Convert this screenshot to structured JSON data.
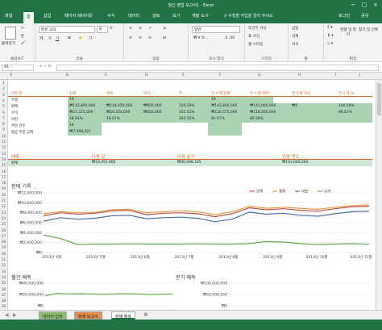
{
  "window": {
    "title": "월간 영업 보고서1 - Excel",
    "min": "−",
    "max": "□",
    "close": "×"
  },
  "ribbon_tabs": [
    "파일",
    "홈",
    "삽입",
    "페이지 레이아웃",
    "수식",
    "데이터",
    "검토",
    "보기",
    "개발 도구"
  ],
  "tell_me": "♀ 수행할 작업을 알려 주세요",
  "account": {
    "login": "로그인",
    "share": "공유"
  },
  "ribbon": {
    "paste": "붙여넣기",
    "clipboard": "클립보드",
    "font_name": "맑은 고딕",
    "font_size": "8",
    "font": "글꼴",
    "alignment": "맞춤",
    "number_format": "일반",
    "number": "표시 형식",
    "cond_format": "조건부 서식",
    "table_format": "표 서식",
    "cell_styles": "셀 스타일",
    "styles": "스타일",
    "insert": "삽입",
    "delete": "삭제",
    "format": "서식",
    "cells": "셀",
    "sort_filter": "정렬 및 필터",
    "find_select": "찾기 및 선택",
    "editing": "편집"
  },
  "name_box": "A1",
  "columns": [
    "A",
    "B",
    "C",
    "D",
    "E",
    "F",
    "G",
    "H",
    "I",
    "J"
  ],
  "rows": [
    "1",
    "2",
    "3",
    "4",
    "5",
    "6",
    "7",
    "8",
    "9",
    "10",
    "11",
    "12",
    "13",
    "14",
    "15",
    "16",
    "17",
    "18",
    "19",
    "20",
    "21",
    "22",
    "23",
    "24",
    "25",
    "26",
    "27",
    "28",
    "29",
    "30",
    "31",
    "32",
    "33",
    "34",
    "35",
    "36",
    "37",
    "38",
    "39"
  ],
  "table": {
    "headers": [
      "이번 달",
      "실제",
      "계획",
      "차이",
      "%",
      "연 누계 실제",
      "연 누계 계획",
      "연 누계 차이",
      "연 누계 %"
    ],
    "rows": [
      [
        "수량",
        "19",
        "",
        "",
        "",
        "19",
        "",
        "",
        ""
      ],
      [
        "판매",
        "₩143,800,000",
        "₩144,650,000",
        "₩850,000",
        "100.59%",
        "₩143,800,000",
        "₩143,000,000",
        "₩0",
        "100.59%"
      ],
      [
        "수익",
        "₩27,225,000",
        "₩26,550,000",
        "₩650,000",
        "102.52%",
        "₩116,575,000",
        "₩116,500,000",
        "",
        "99.41%"
      ],
      [
        "마진",
        "18.93%",
        "19.41%",
        "",
        "102.52%",
        "81.07%",
        "80.59%",
        "",
        ""
      ],
      [
        "주문 건수",
        "19",
        "",
        "",
        "",
        "-",
        "",
        "",
        ""
      ],
      [
        "평균 주문 금액",
        "₩7,568,421",
        "",
        "",
        "",
        "-",
        "",
        "",
        ""
      ]
    ]
  },
  "forecast": {
    "labels": [
      "예측",
      "다음 달",
      "다음 분기",
      "연중 연도"
    ],
    "row_label": "판매",
    "values": [
      "₩19,451,904",
      "₩46,098,185",
      "₩143,000,000"
    ]
  },
  "sales_history": {
    "title": "판매 기록"
  },
  "monthly_forecast": {
    "title": "월간 예측",
    "ticks": [
      "₩40,000,000",
      "₩20,000,000",
      "₩0"
    ]
  },
  "quarterly_forecast": {
    "title": "분기 예측",
    "ticks": [
      "₩100,000,000",
      "₩50,000,000",
      "₩0"
    ]
  },
  "sheet_tabs": [
    "데이터 입력",
    "판매 보고서",
    "판매 예측"
  ],
  "colors": {
    "excel_green": "#217346",
    "accent_orange": "#d06b2b",
    "cell_green": "#a9d3b3",
    "tab_green": "#8dbf6a",
    "tab_orange": "#e58c4a"
  },
  "chart_data": [
    {
      "type": "line",
      "title": "판매 기록",
      "x": [
        "2013년 4월",
        "2013년 5월",
        "2013년 6월",
        "2013년 7월",
        "2013년 8월",
        "2013년 9월",
        "2013년 10월",
        "2013년 11월"
      ],
      "ylim": [
        0,
        12000000
      ],
      "yticks": [
        "₩12,000,000",
        "₩10,000,000",
        "₩8,000,000",
        "₩6,000,000",
        "₩4,000,000",
        "₩2,000,000",
        "₩0"
      ],
      "legend_position": "top-right",
      "series": [
        {
          "name": "금액",
          "color": "#c0504d",
          "values": [
            7400000,
            8000000,
            7700000,
            7900000,
            8400000,
            8500000,
            7600000,
            7900000,
            8000000,
            7800000,
            7200000,
            7800000,
            9000000,
            8600000,
            8800000,
            8500000,
            8300000,
            8800000,
            9200000,
            9300000
          ]
        },
        {
          "name": "계획",
          "color": "#e0a14a",
          "values": [
            7800000,
            8200000,
            8000000,
            8100000,
            8600000,
            8700000,
            8000000,
            8200000,
            8400000,
            8200000,
            7600000,
            8200000,
            9300000,
            8900000,
            9100000,
            8900000,
            8700000,
            9100000,
            9400000,
            9600000
          ]
        },
        {
          "name": "비용",
          "color": "#4f6ea8",
          "values": [
            6300000,
            7000000,
            6700000,
            6900000,
            7400000,
            7500000,
            6800000,
            7000000,
            7100000,
            6900000,
            6200000,
            6700000,
            8100000,
            7700000,
            7900000,
            7500000,
            7300000,
            7800000,
            8200000,
            8300000
          ]
        },
        {
          "name": "수익",
          "color": "#6aa84f",
          "values": [
            3500000,
            2800000,
            1600000,
            1700000,
            1700000,
            1750000,
            1700000,
            1700000,
            1700000,
            1750000,
            1700000,
            1700000,
            1800000,
            2200000,
            2100000,
            1800000,
            1600000,
            1700000,
            1800000,
            1650000
          ]
        }
      ]
    },
    {
      "type": "line",
      "title": "월간 예측",
      "ylim": [
        0,
        40000000
      ],
      "series": [
        {
          "name": "",
          "color": "#6aa84f",
          "values": [
            18000000,
            22000000,
            21000000,
            21500000,
            21000000,
            20500000,
            21000000,
            21500000,
            21000000,
            20000000,
            20500000,
            21000000
          ]
        }
      ]
    },
    {
      "type": "line",
      "title": "분기 예측",
      "ylim": [
        0,
        100000000
      ],
      "series": [
        {
          "name": "",
          "color": "#6aa84f",
          "values": []
        }
      ]
    }
  ]
}
